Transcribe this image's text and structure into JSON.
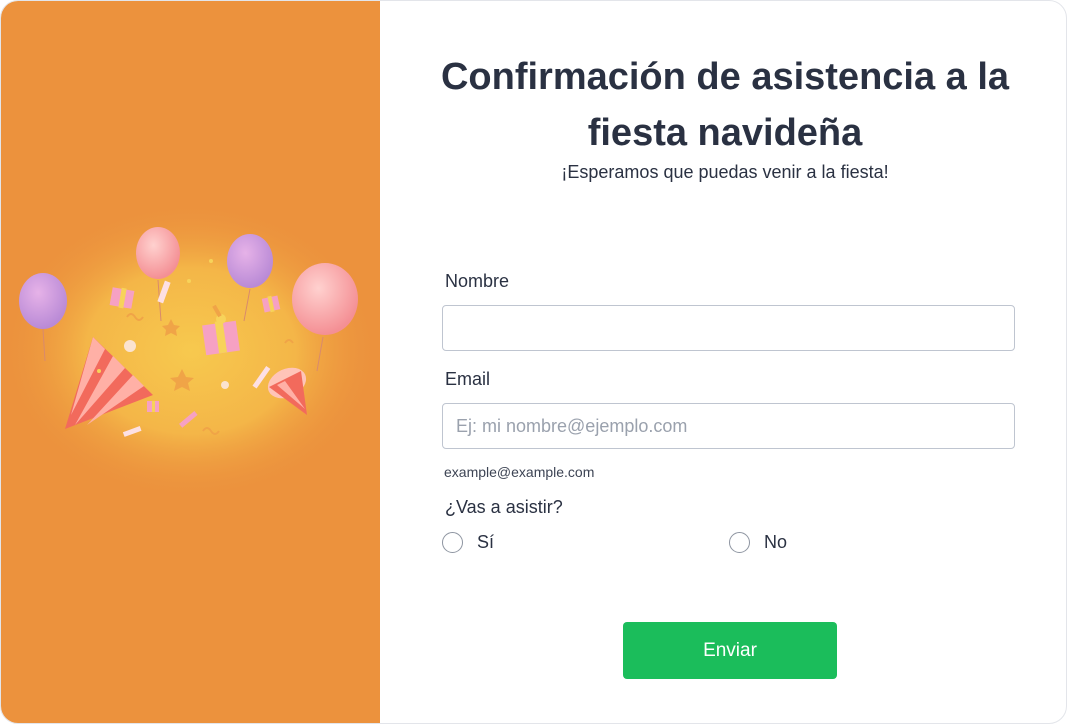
{
  "header": {
    "title": "Confirmación de asistencia a la fiesta navideña",
    "subtitle": "¡Esperamos que puedas venir a la fiesta!"
  },
  "form": {
    "name_label": "Nombre",
    "name_value": "",
    "email_label": "Email",
    "email_placeholder": "Ej: mi nombre@ejemplo.com",
    "email_sublabel": "example@example.com",
    "attend_label": "¿Vas a asistir?",
    "options": [
      "Sí",
      "No"
    ],
    "submit_label": "Enviar"
  },
  "colors": {
    "side_panel": "#ec923d",
    "submit": "#1bbd5b",
    "text": "#2a3142"
  },
  "illustration": {
    "icons": [
      "balloon-icon",
      "party-hat-icon",
      "gift-icon",
      "confetti-icon"
    ]
  }
}
